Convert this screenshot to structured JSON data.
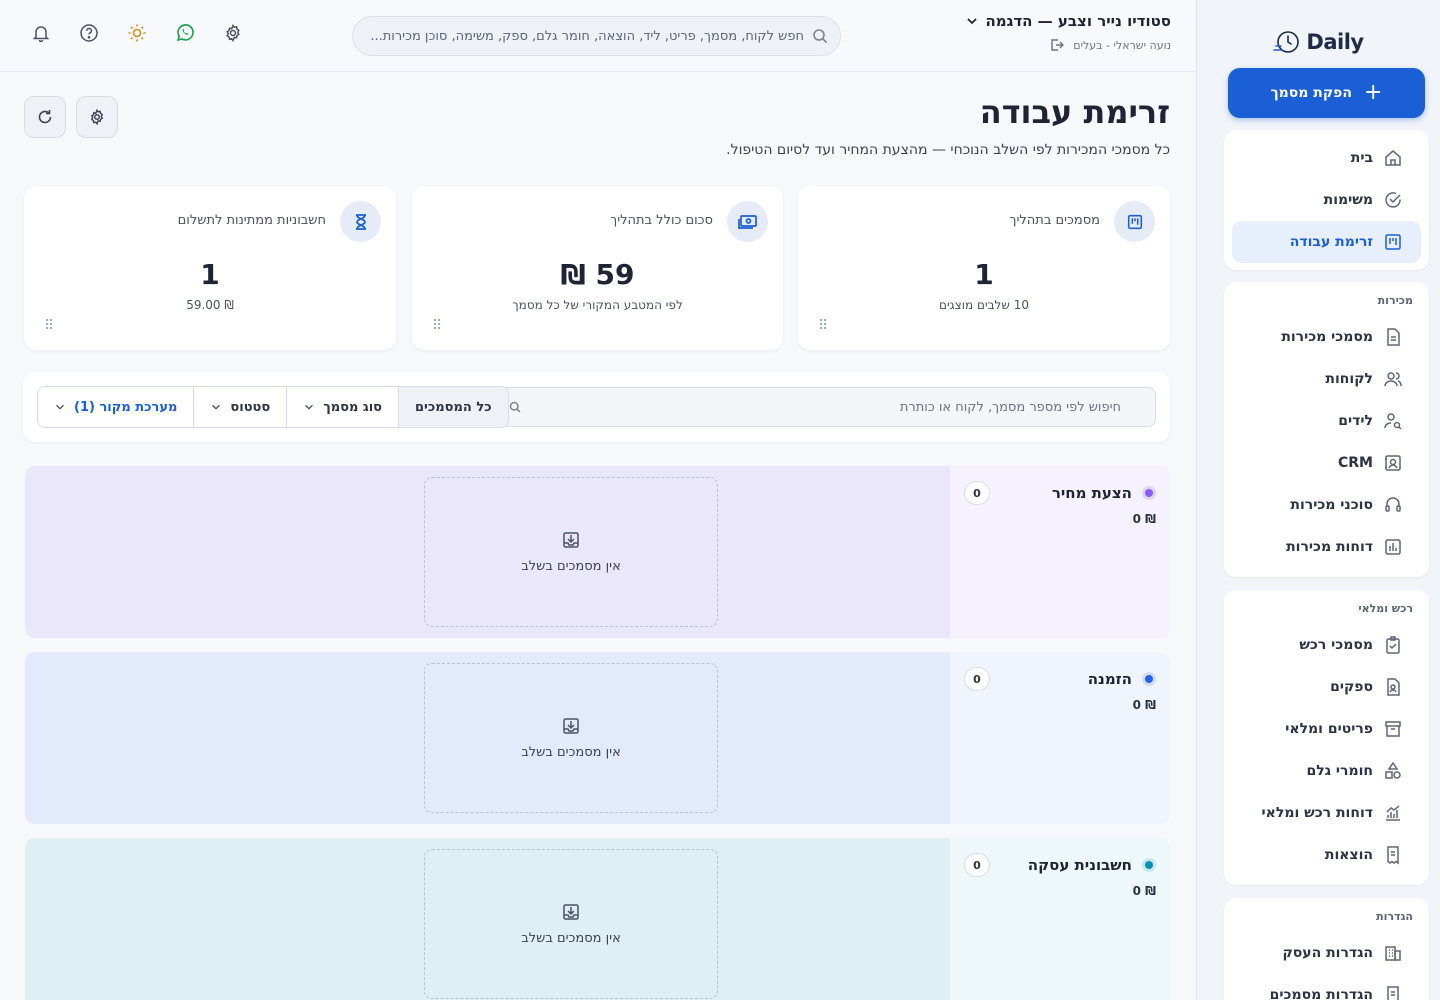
{
  "app": {
    "logo_text": "Daily",
    "new_button": "הפקת מסמך"
  },
  "sidebar": {
    "main_items": [
      {
        "label": "בית",
        "icon": "home-icon"
      },
      {
        "label": "משימות",
        "icon": "check-circle-icon"
      },
      {
        "label": "זרימת עבודה",
        "icon": "kanban-icon",
        "active": true
      }
    ],
    "sales": {
      "title": "מכירות",
      "items": [
        {
          "label": "מסמכי מכירות",
          "icon": "document-icon"
        },
        {
          "label": "לקוחות",
          "icon": "users-icon"
        },
        {
          "label": "לידים",
          "icon": "user-search-icon"
        },
        {
          "label": "CRM",
          "icon": "contact-card-icon"
        },
        {
          "label": "סוכני מכירות",
          "icon": "headset-icon"
        },
        {
          "label": "דוחות מכירות",
          "icon": "bar-chart-icon"
        }
      ]
    },
    "purchase": {
      "title": "רכש ומלאי",
      "items": [
        {
          "label": "מסמכי רכש",
          "icon": "clipboard-check-icon"
        },
        {
          "label": "ספקים",
          "icon": "supplier-icon"
        },
        {
          "label": "פריטים ומלאי",
          "icon": "archive-icon"
        },
        {
          "label": "חומרי גלם",
          "icon": "shapes-icon"
        },
        {
          "label": "דוחות רכש ומלאי",
          "icon": "line-chart-icon"
        },
        {
          "label": "הוצאות",
          "icon": "receipt-icon"
        }
      ]
    },
    "settings": {
      "title": "הגדרות",
      "items": [
        {
          "label": "הגדרות העסק",
          "icon": "building-icon"
        },
        {
          "label": "הגדרות מסמכים",
          "icon": "doc-settings-icon"
        }
      ]
    }
  },
  "header": {
    "business_name": "סטודיו נייר וצבע — הדגמה",
    "user_line": "נועה ישראלי - בעלים",
    "search_placeholder": "חפש לקוח, מסמך, פריט, ליד, הוצאה, חומר גלם, ספק, משימה, סוכן מכירות..."
  },
  "page": {
    "title": "זרימת עבודה",
    "subtitle": "כל מסמכי המכירות לפי השלב הנוכחי — מהצעת המחיר ועד לסיום הטיפול."
  },
  "stats": [
    {
      "label": "מסמכים בתהליך",
      "value": "1",
      "sub": "10 שלבים מוצגים",
      "icon": "kanban-icon"
    },
    {
      "label": "סכום כולל בתהליך",
      "value": "59 ₪",
      "sub": "לפי המטבע המקורי של כל מסמך",
      "icon": "cash-icon"
    },
    {
      "label": "חשבוניות ממתינות לתשלום",
      "value": "1",
      "sub": "₪ 59.00",
      "icon": "hourglass-icon"
    }
  ],
  "filters": {
    "search_placeholder": "חיפוש לפי מספר מסמך, לקוח או כותרת",
    "all_docs": "כל המסמכים",
    "doc_type": "סוג מסמך",
    "status": "סטטוס",
    "source": "מערכת מקור (1)"
  },
  "stages": [
    {
      "name": "הצעת מחיר",
      "count": "0",
      "amount": "₪ 0",
      "empty_text": "אין מסמכים בשלב",
      "color": "#8b5cf6"
    },
    {
      "name": "הזמנה",
      "count": "0",
      "amount": "₪ 0",
      "empty_text": "אין מסמכים בשלב",
      "color": "#2563eb"
    },
    {
      "name": "חשבונית עסקה",
      "count": "0",
      "amount": "₪ 0",
      "empty_text": "אין מסמכים בשלב",
      "color": "#0891b2"
    }
  ]
}
